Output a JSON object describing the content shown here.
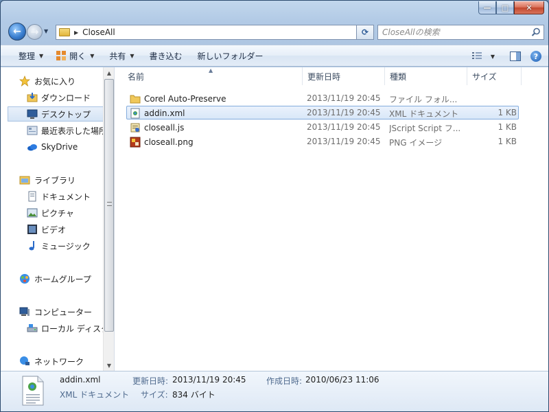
{
  "window": {
    "caption_buttons": {
      "minimize": "—",
      "maximize": "□",
      "close": "✕"
    }
  },
  "address": {
    "path": "CloseAll",
    "search_placeholder": "CloseAllの検索"
  },
  "toolbar": {
    "organize": "整理",
    "open": "開く",
    "share": "共有",
    "burn": "書き込む",
    "new_folder": "新しいフォルダー"
  },
  "sidebar": {
    "favorites": {
      "label": "お気に入り",
      "items": [
        {
          "label": "ダウンロード",
          "icon": "download-folder-icon"
        },
        {
          "label": "デスクトップ",
          "icon": "desktop-icon"
        },
        {
          "label": "最近表示した場所",
          "icon": "recent-places-icon"
        },
        {
          "label": "SkyDrive",
          "icon": "skydrive-icon"
        }
      ]
    },
    "libraries": {
      "label": "ライブラリ",
      "items": [
        {
          "label": "ドキュメント",
          "icon": "documents-icon"
        },
        {
          "label": "ピクチャ",
          "icon": "pictures-icon"
        },
        {
          "label": "ビデオ",
          "icon": "videos-icon"
        },
        {
          "label": "ミュージック",
          "icon": "music-icon"
        }
      ]
    },
    "homegroup": {
      "label": "ホームグループ"
    },
    "computer": {
      "label": "コンピューター",
      "items": [
        {
          "label": "ローカル ディスク (C:)",
          "icon": "local-disk-icon"
        }
      ]
    },
    "network": {
      "label": "ネットワーク"
    }
  },
  "file_list": {
    "columns": {
      "name": "名前",
      "date": "更新日時",
      "type": "種類",
      "size": "サイズ"
    },
    "rows": [
      {
        "name": "Corel Auto-Preserve",
        "date": "2013/11/19 20:45",
        "type": "ファイル フォル...",
        "size": "",
        "icon": "folder-icon"
      },
      {
        "name": "addin.xml",
        "date": "2013/11/19 20:45",
        "type": "XML ドキュメント",
        "size": "1 KB",
        "icon": "xml-file-icon"
      },
      {
        "name": "closeall.js",
        "date": "2013/11/19 20:45",
        "type": "JScript Script フ...",
        "size": "1 KB",
        "icon": "script-file-icon"
      },
      {
        "name": "closeall.png",
        "date": "2013/11/19 20:45",
        "type": "PNG イメージ",
        "size": "1 KB",
        "icon": "png-file-icon"
      }
    ]
  },
  "details": {
    "filename": "addin.xml",
    "type": "XML ドキュメント",
    "modified_label": "更新日時:",
    "modified_value": "2013/11/19 20:45",
    "created_label": "作成日時:",
    "created_value": "2010/06/23 11:06",
    "size_label": "サイズ:",
    "size_value": "834 バイト"
  },
  "colors": {
    "selection_border": "#84acdd",
    "label_blue": "#4f6a8e"
  }
}
